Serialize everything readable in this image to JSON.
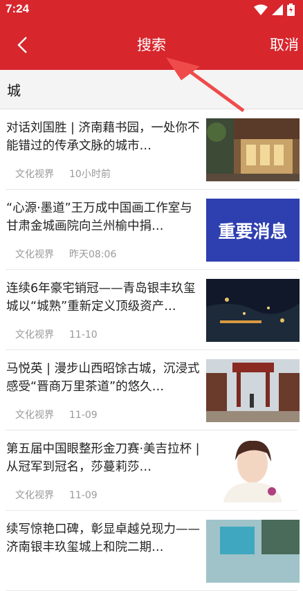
{
  "status_bar": {
    "time": "7:24"
  },
  "header": {
    "title": "搜索",
    "cancel_label": "取消"
  },
  "search": {
    "value": "城"
  },
  "articles": [
    {
      "headline": "对话刘国胜 | 济南藉书园，一处你不能错过的传承文脉的城市…",
      "source": "文化视界",
      "time": "10小时前"
    },
    {
      "headline": "“心源·墨道”王万成中国画工作室与甘肃金城画院向兰州榆中捐…",
      "source": "文化视界",
      "time": "昨天08:06",
      "thumb_text": "重要消息"
    },
    {
      "headline": "连续6年豪宅销冠——青岛银丰玖玺城以“城熟”重新定义顶级资产…",
      "source": "文化视界",
      "time": "11-10"
    },
    {
      "headline": "马悦英 | 漫步山西昭馀古城，沉浸式感受“晋商万里茶道”的悠久…",
      "source": "文化视界",
      "time": "11-09"
    },
    {
      "headline": "第五届中国眼整形金刀赛·美吉拉杯 | 从冠军到冠名，莎蔓莉莎…",
      "source": "文化视界",
      "time": "11-09"
    },
    {
      "headline": "续写惊艳口碑，彰显卓越兑现力——济南银丰玖玺城上和院二期…",
      "source": "",
      "time": ""
    }
  ],
  "colors": {
    "brand_red": "#d8262d",
    "thumb_blue": "#2e3fb0"
  }
}
